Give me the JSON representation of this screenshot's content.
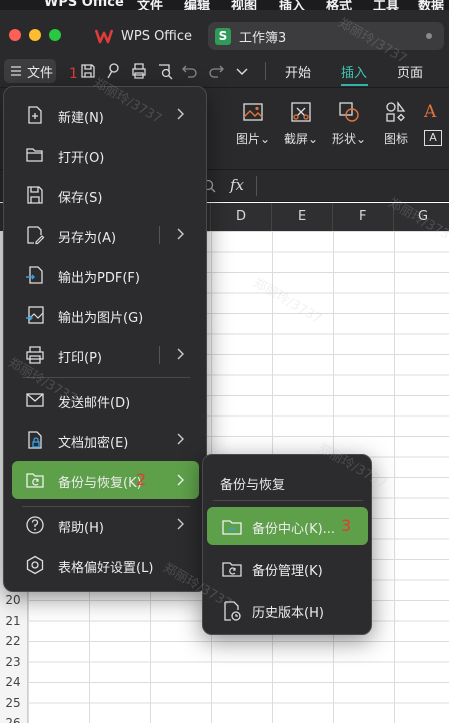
{
  "mac_menubar": {
    "items": [
      "",
      "WPS Office",
      "文件",
      "编辑",
      "视图",
      "插入",
      "格式",
      "工具",
      "数据"
    ]
  },
  "tabs": [
    {
      "label": "WPS Office",
      "icon": "wps-logo-icon"
    },
    {
      "label": "工作簿3",
      "icon": "sheet-s-icon"
    }
  ],
  "toolbar": {
    "file_menu_label": "文件",
    "ribbon_tabs": [
      "开始",
      "插入",
      "页面"
    ],
    "active_ribbon_tab": "插入"
  },
  "ribbon": {
    "items": [
      {
        "label": "图片",
        "dropdown": "⌄",
        "icon": "image-icon"
      },
      {
        "label": "截屏",
        "dropdown": "⌄",
        "icon": "screenshot-icon"
      },
      {
        "label": "形状",
        "dropdown": "⌄",
        "icon": "shapes-icon"
      },
      {
        "label": "图标",
        "dropdown": "",
        "icon": "icons-icon"
      }
    ]
  },
  "formula_bar": {
    "fx": "fx"
  },
  "columns": [
    "D",
    "E",
    "F",
    "G"
  ],
  "rows": [
    "20",
    "21",
    "22",
    "23",
    "24",
    "25",
    "26"
  ],
  "file_menu": {
    "items": [
      {
        "label": "新建(N)",
        "has_submenu": true,
        "icon": "new-file-icon"
      },
      {
        "label": "打开(O)",
        "has_submenu": false,
        "icon": "folder-open-icon"
      },
      {
        "label": "保存(S)",
        "has_submenu": false,
        "icon": "save-icon"
      },
      {
        "label": "另存为(A)",
        "has_submenu": true,
        "icon": "save-as-icon"
      },
      {
        "label": "输出为PDF(F)",
        "has_submenu": false,
        "icon": "export-pdf-icon"
      },
      {
        "label": "输出为图片(G)",
        "has_submenu": false,
        "icon": "export-image-icon"
      },
      {
        "label": "打印(P)",
        "has_submenu": true,
        "icon": "printer-icon"
      },
      {
        "label": "发送邮件(D)",
        "has_submenu": false,
        "icon": "mail-icon"
      },
      {
        "label": "文档加密(E)",
        "has_submenu": true,
        "icon": "encrypt-icon"
      },
      {
        "label": "备份与恢复(K)",
        "has_submenu": true,
        "icon": "backup-restore-icon",
        "active": true
      },
      {
        "label": "帮助(H)",
        "has_submenu": true,
        "icon": "help-icon"
      },
      {
        "label": "表格偏好设置(L)",
        "has_submenu": false,
        "icon": "settings-icon"
      }
    ]
  },
  "backup_submenu": {
    "title": "备份与恢复",
    "items": [
      {
        "label": "备份中心(K)...",
        "icon": "backup-center-icon",
        "active": true
      },
      {
        "label": "备份管理(K)",
        "icon": "backup-manage-icon"
      },
      {
        "label": "历史版本(H)",
        "icon": "history-version-icon"
      }
    ]
  },
  "annotations": [
    "1",
    "2",
    "3"
  ],
  "watermark": "郑丽玲/3737",
  "colors": {
    "accent_green": "#5ea04a",
    "active_tab_underline": "#2fb5a5",
    "annotation_red": "#e53935"
  }
}
